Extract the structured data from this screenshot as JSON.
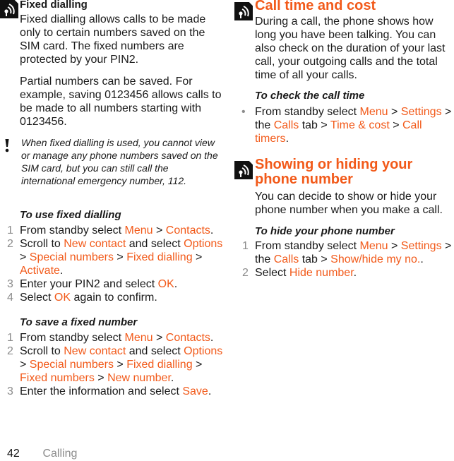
{
  "left": {
    "section_title": "Fixed dialling",
    "icon": "tips-signal-icon",
    "para1": "Fixed dialling allows calls to be made only to certain numbers saved on the SIM card. The fixed numbers are protected by your PIN2.",
    "para2": "Partial numbers can be saved. For example, saving 0123456 allows calls to be made to all numbers starting with 0123456.",
    "note": {
      "icon": "exclamation-icon",
      "text": "When fixed dialling is used, you cannot view or manage any phone numbers saved on the SIM card, but you can still call the international emergency number, 112."
    },
    "use_fixed": {
      "title": "To use fixed dialling",
      "steps": [
        {
          "n": "1",
          "parts": [
            {
              "t": "From standby select "
            },
            {
              "h": "Menu"
            },
            {
              "t": " > "
            },
            {
              "h": "Contacts"
            },
            {
              "t": "."
            }
          ]
        },
        {
          "n": "2",
          "parts": [
            {
              "t": "Scroll to "
            },
            {
              "h": "New contact"
            },
            {
              "t": " and select "
            },
            {
              "h": "Options"
            },
            {
              "t": " > "
            },
            {
              "h": "Special numbers"
            },
            {
              "t": " > "
            },
            {
              "h": "Fixed dialling"
            },
            {
              "t": " > "
            },
            {
              "h": "Activate"
            },
            {
              "t": "."
            }
          ]
        },
        {
          "n": "3",
          "parts": [
            {
              "t": "Enter your PIN2 and select "
            },
            {
              "h": "OK"
            },
            {
              "t": "."
            }
          ]
        },
        {
          "n": "4",
          "parts": [
            {
              "t": "Select "
            },
            {
              "h": "OK"
            },
            {
              "t": " again to confirm."
            }
          ]
        }
      ]
    },
    "save_fixed": {
      "title": "To save a fixed number",
      "steps": [
        {
          "n": "1",
          "parts": [
            {
              "t": "From standby select "
            },
            {
              "h": "Menu"
            },
            {
              "t": " > "
            },
            {
              "h": "Contacts"
            },
            {
              "t": "."
            }
          ]
        },
        {
          "n": "2",
          "parts": [
            {
              "t": "Scroll to "
            },
            {
              "h": "New contact"
            },
            {
              "t": " and select "
            },
            {
              "h": "Options"
            },
            {
              "t": " > "
            },
            {
              "h": "Special numbers"
            },
            {
              "t": " > "
            },
            {
              "h": "Fixed dialling"
            },
            {
              "t": " > "
            },
            {
              "h": "Fixed numbers"
            },
            {
              "t": " > "
            },
            {
              "h": "New number"
            },
            {
              "t": "."
            }
          ]
        },
        {
          "n": "3",
          "parts": [
            {
              "t": "Enter the information and select "
            },
            {
              "h": "Save"
            },
            {
              "t": "."
            }
          ]
        }
      ]
    }
  },
  "right": {
    "call_time": {
      "title": "Call time and cost",
      "icon": "tips-signal-icon",
      "para": "During a call, the phone shows how long you have been talking. You can also check on the duration of your last call, your outgoing calls and the total time of all your calls.",
      "sub_title": "To check the call time",
      "bullet": "•",
      "step_parts": [
        {
          "t": "From standby select "
        },
        {
          "h": "Menu"
        },
        {
          "t": " > "
        },
        {
          "h": "Settings"
        },
        {
          "t": " > the "
        },
        {
          "h": "Calls"
        },
        {
          "t": " tab > "
        },
        {
          "h": "Time & cost"
        },
        {
          "t": " > "
        },
        {
          "h": "Call timers"
        },
        {
          "t": "."
        }
      ]
    },
    "show_hide": {
      "title": "Showing or hiding your phone number",
      "icon": "tips-signal-icon",
      "para": "You can decide to show or hide your phone number when you make a call.",
      "sub_title": "To hide your phone number",
      "steps": [
        {
          "n": "1",
          "parts": [
            {
              "t": "From standby select "
            },
            {
              "h": "Menu"
            },
            {
              "t": " > "
            },
            {
              "h": "Settings"
            },
            {
              "t": " > the "
            },
            {
              "h": "Calls"
            },
            {
              "t": " tab > "
            },
            {
              "h": "Show/hide my no."
            },
            {
              "t": "."
            }
          ]
        },
        {
          "n": "2",
          "parts": [
            {
              "t": "Select "
            },
            {
              "h": "Hide number"
            },
            {
              "t": "."
            }
          ]
        }
      ]
    }
  },
  "footer": {
    "page_number": "42",
    "section": "Calling"
  },
  "colors": {
    "highlight": "#f25a1a",
    "step_number": "#8c8c8c",
    "text": "#1a1a1a"
  }
}
